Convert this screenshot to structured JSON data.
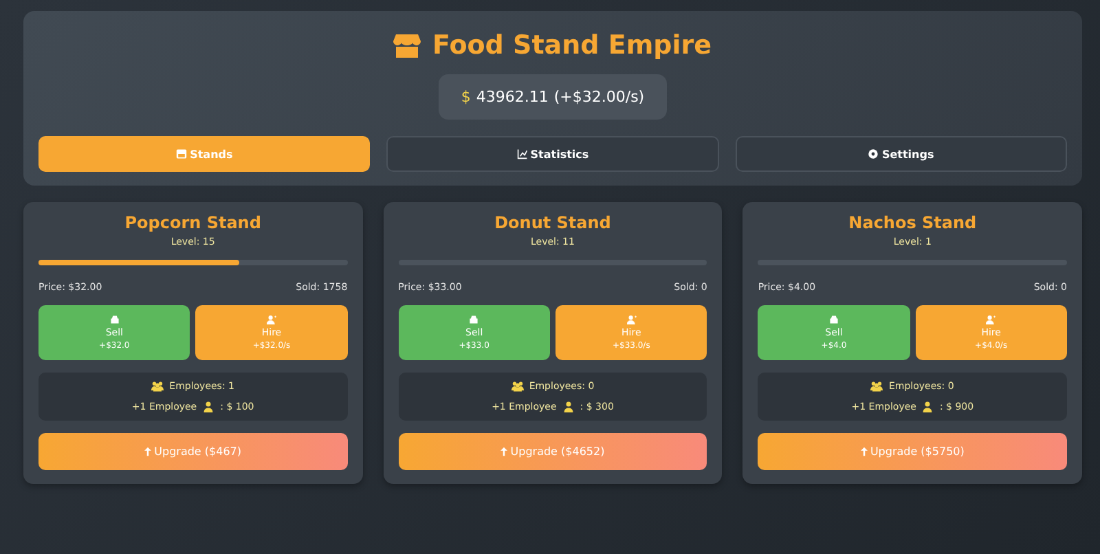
{
  "header": {
    "title": "Food Stand Empire",
    "money": "43962.11",
    "money_sign": "$",
    "rate": "(+$32.00/s)"
  },
  "tabs": [
    {
      "label": "Stands",
      "selected": true
    },
    {
      "label": "Statistics",
      "selected": false
    },
    {
      "label": "Settings",
      "selected": false
    }
  ],
  "stands": [
    {
      "name": "Popcorn Stand",
      "level_text": "Level: 15",
      "level": 0.65,
      "price": "Price: $32.00",
      "sold": "Sold: 1758",
      "sell_label": "Sell",
      "sell_amount": "+$32.0",
      "hire_label": "Hire",
      "hire_amount": "+$32.0/s",
      "employees": "Employees: 1",
      "employee_cost_label": "+1 Employee",
      "employee_cost": ": $ 100",
      "upgrade": "Upgrade ($467)"
    },
    {
      "name": "Donut Stand",
      "level_text": "Level: 11",
      "level": 0,
      "price": "Price: $33.00",
      "sold": "Sold: 0",
      "sell_label": "Sell",
      "sell_amount": "+$33.0",
      "hire_label": "Hire",
      "hire_amount": "+$33.0/s",
      "employees": "Employees: 0",
      "employee_cost_label": "+1 Employee",
      "employee_cost": ": $ 300",
      "upgrade": "Upgrade ($4652)"
    },
    {
      "name": "Nachos Stand",
      "level_text": "Level: 1",
      "level": 0,
      "price": "Price: $4.00",
      "sold": "Sold: 0",
      "sell_label": "Sell",
      "sell_amount": "+$4.0",
      "hire_label": "Hire",
      "hire_amount": "+$4.0/s",
      "employees": "Employees: 0",
      "employee_cost_label": "+1 Employee",
      "employee_cost": ": $ 900",
      "upgrade": "Upgrade ($5750)"
    }
  ]
}
